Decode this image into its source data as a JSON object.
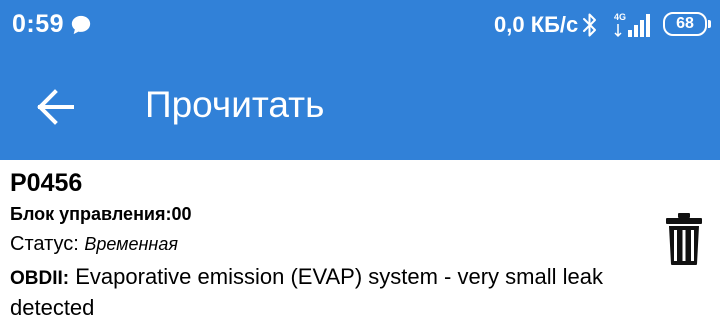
{
  "status_bar": {
    "time": "0:59",
    "network_speed": "0,0 КБ/с",
    "network_type": "4G",
    "battery_level": "68",
    "icons": [
      "chat-icon",
      "bluetooth-icon",
      "signal-icon",
      "battery-icon"
    ]
  },
  "app_bar": {
    "title": "Прочитать",
    "back_icon": "arrow-left-icon",
    "background_color": "#3181d8"
  },
  "codes": [
    {
      "code": "P0456",
      "ecu_label": "Блок управления:",
      "ecu_value": "00",
      "status_label": "Статус:",
      "status_value": "Временная",
      "obd_label": "OBDII:",
      "description": "Evaporative emission (EVAP) system - very small leak detected",
      "delete_icon": "trash-icon"
    }
  ]
}
